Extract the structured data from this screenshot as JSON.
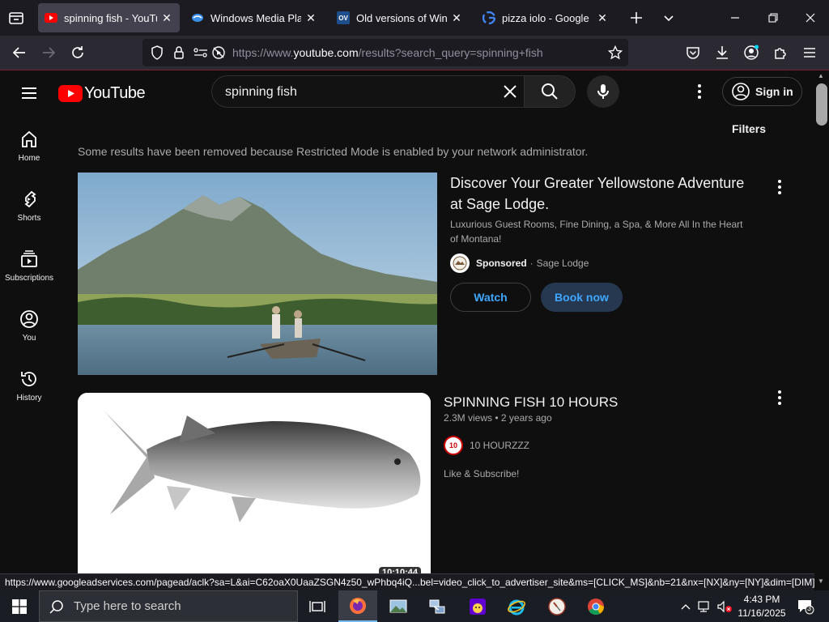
{
  "browser": {
    "tabs": [
      {
        "title": "spinning fish - YouTube",
        "favicon": "youtube-favicon",
        "active": true
      },
      {
        "title": "Windows Media Player",
        "favicon": "wmp-favicon",
        "active": false
      },
      {
        "title": "Old versions of Window",
        "favicon": "ov-favicon",
        "active": false
      },
      {
        "title": "pizza iolo - Google Sea",
        "favicon": "google-favicon",
        "active": false
      }
    ],
    "ov_badge": "OV",
    "url_prefix": "https://www.",
    "url_host": "youtube.com",
    "url_path": "/results?search_query=spinning+fish"
  },
  "youtube": {
    "logo_text": "YouTube",
    "search_value": "spinning fish",
    "sign_in": "Sign in",
    "filters": "Filters",
    "notice": "Some results have been removed because Restricted Mode is enabled by your network administrator.",
    "sidebar": [
      {
        "label": "Home",
        "icon": "home-icon"
      },
      {
        "label": "Shorts",
        "icon": "shorts-icon"
      },
      {
        "label": "Subscriptions",
        "icon": "subscriptions-icon"
      },
      {
        "label": "You",
        "icon": "you-icon"
      },
      {
        "label": "History",
        "icon": "history-icon"
      }
    ],
    "ad": {
      "title": "Discover Your Greater Yellowstone Adventure at Sage Lodge.",
      "description": "Luxurious Guest Rooms, Fine Dining, a Spa, & More All In the Heart of Montana!",
      "sponsored": "Sponsored",
      "advertiser": "Sage Lodge",
      "watch_label": "Watch",
      "book_label": "Book now"
    },
    "video": {
      "title": "SPINNING FISH 10 HOURS",
      "views": "2.3M views",
      "age": "2 years ago",
      "channel": "10 HOURZZZ",
      "channel_badge": "10",
      "description": "Like & Subscribe!",
      "duration": "10:10:44"
    }
  },
  "status_url": "https://www.googleadservices.com/pagead/aclk?sa=L&ai=C62oaX0UaaZSGN4z50_wPhbq4iQ...bel=video_click_to_advertiser_site&ms=[CLICK_MS]&nb=21&nx=[NX]&ny=[NY]&dim=[DIM]",
  "taskbar": {
    "search_placeholder": "Type here to search",
    "time": "4:43 PM",
    "date": "11/16/2025",
    "notification_count": "3"
  },
  "colors": {
    "yt_red": "#ff0000",
    "link_blue": "#3ea6ff",
    "page_bg": "#0f0f0f"
  }
}
